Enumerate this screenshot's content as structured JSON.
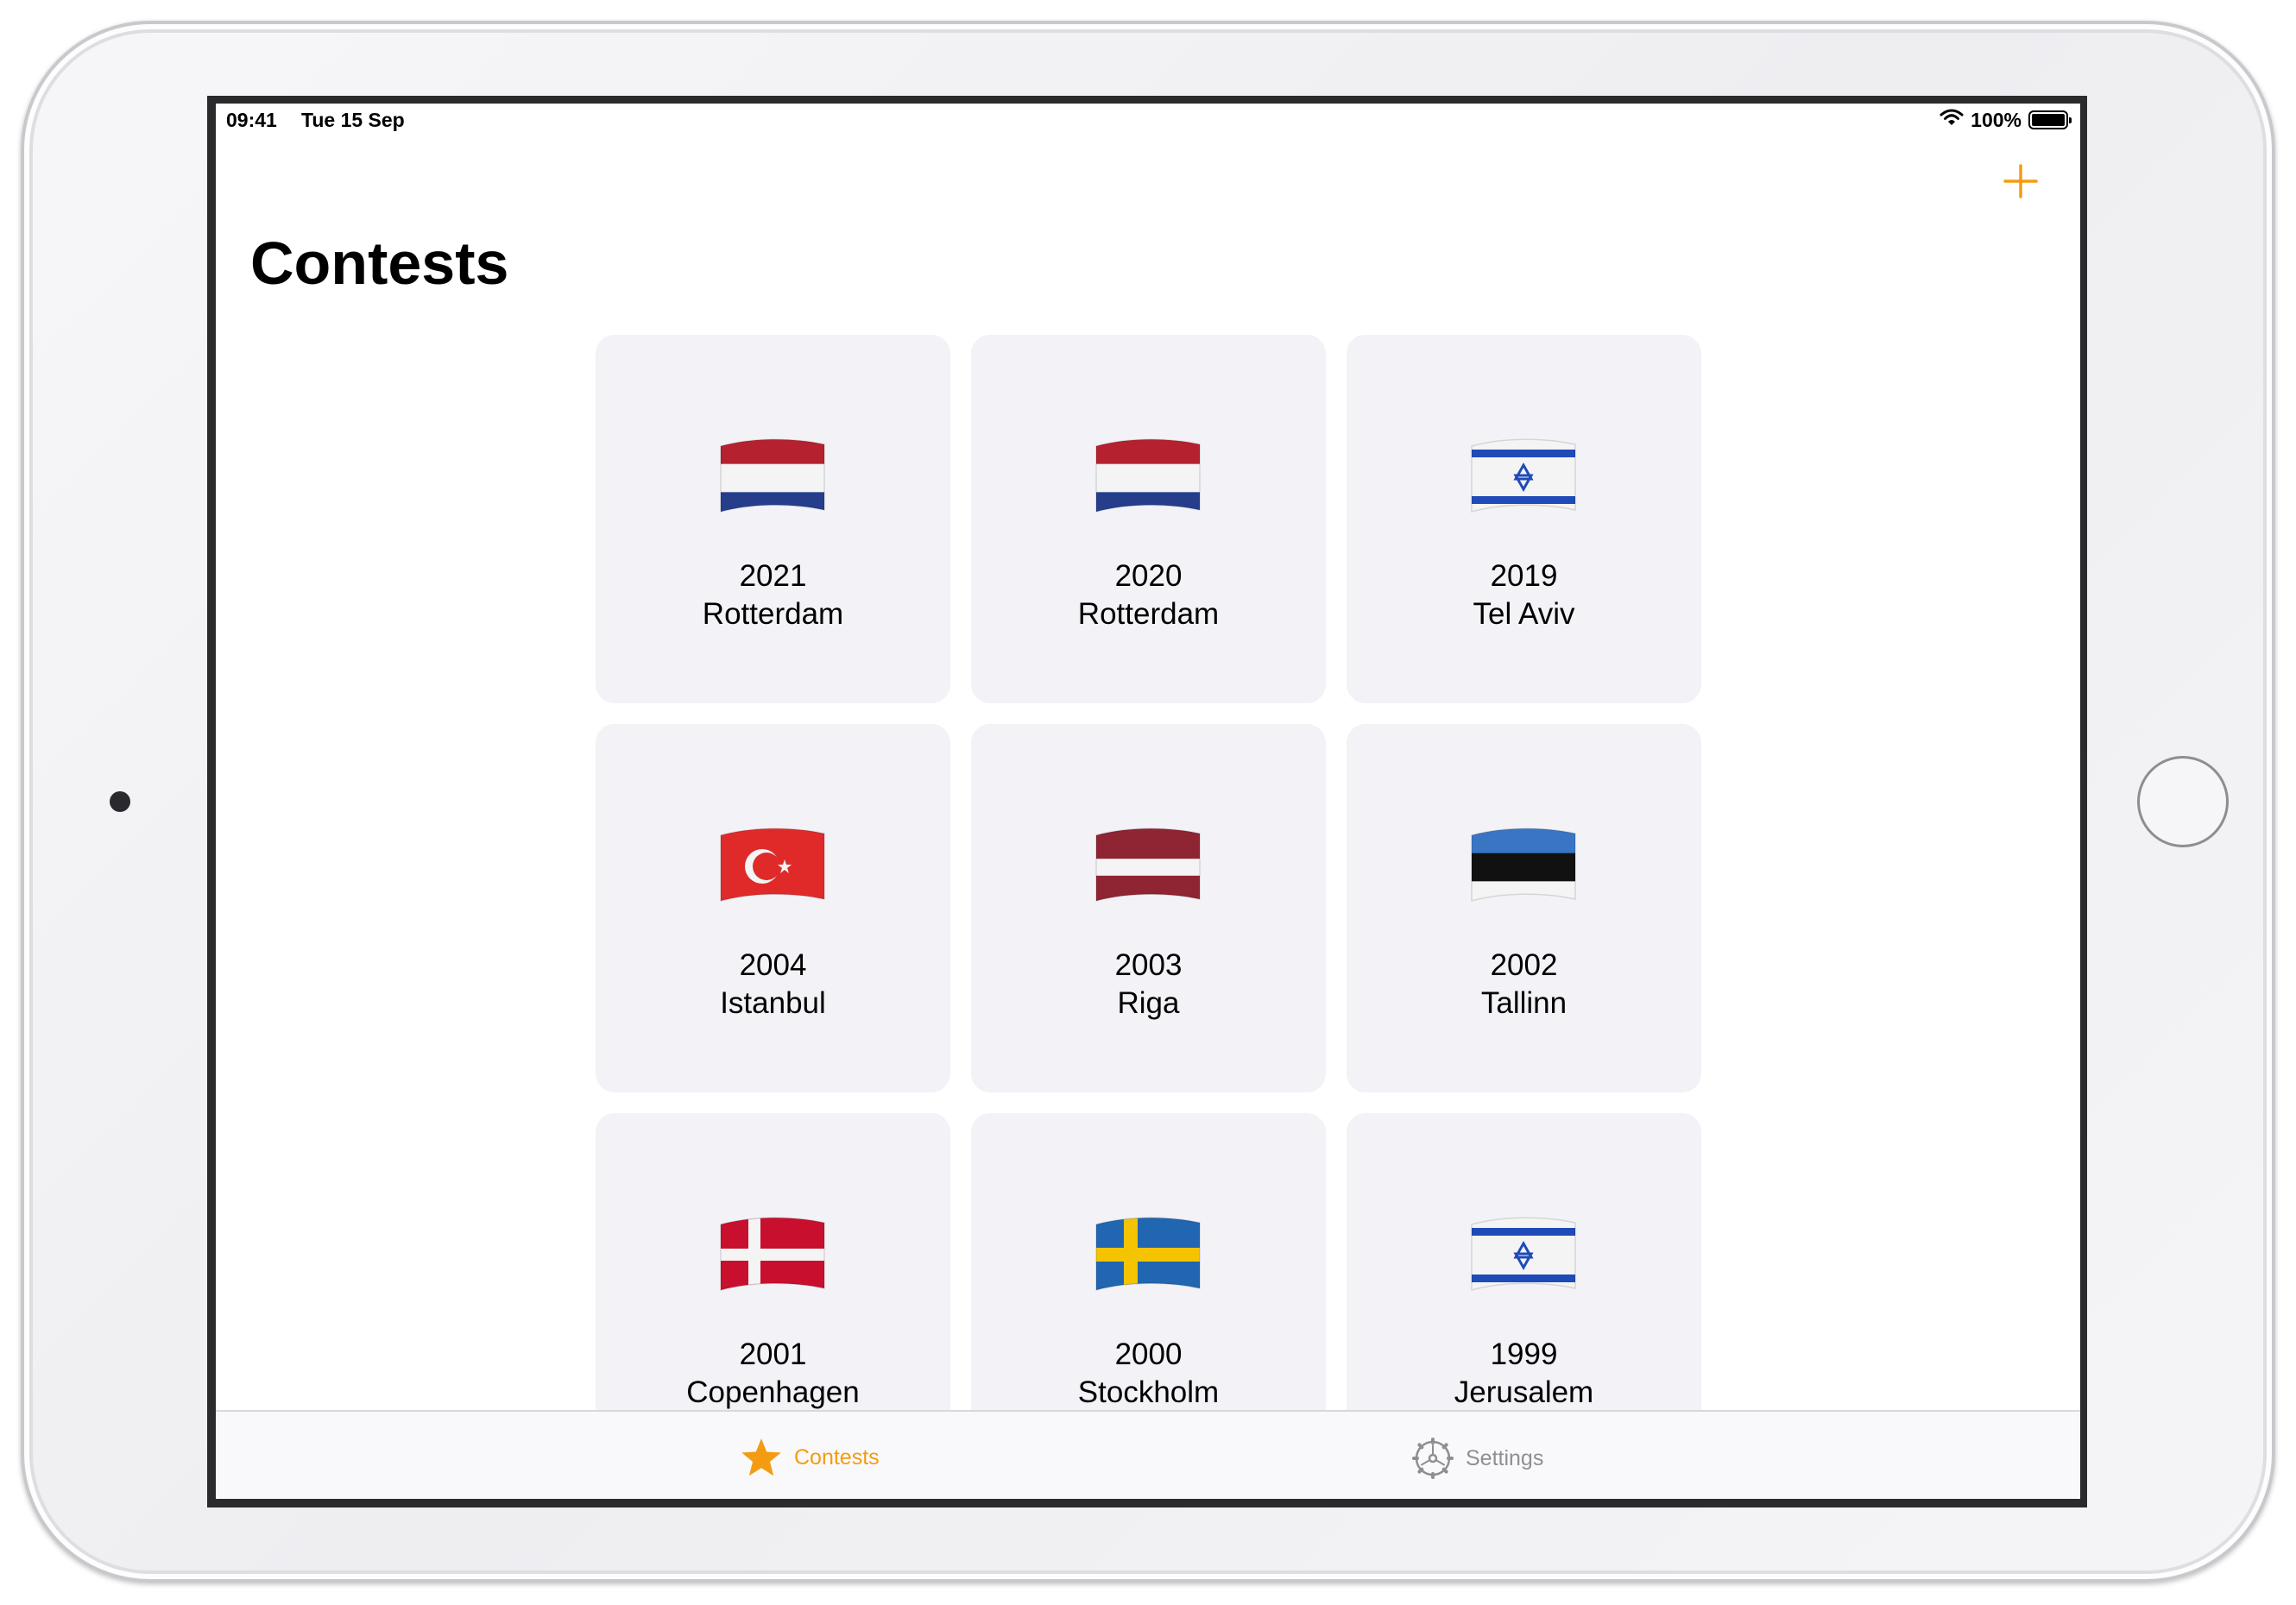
{
  "status_bar": {
    "time": "09:41",
    "date": "Tue 15 Sep",
    "battery": "100%"
  },
  "nav": {
    "title": "Contests",
    "add_icon": "plus-icon"
  },
  "contests": [
    {
      "year": "2021",
      "city": "Rotterdam",
      "flag": "netherlands"
    },
    {
      "year": "2020",
      "city": "Rotterdam",
      "flag": "netherlands"
    },
    {
      "year": "2019",
      "city": "Tel Aviv",
      "flag": "israel"
    },
    {
      "year": "2004",
      "city": "Istanbul",
      "flag": "turkey"
    },
    {
      "year": "2003",
      "city": "Riga",
      "flag": "latvia"
    },
    {
      "year": "2002",
      "city": "Tallinn",
      "flag": "estonia"
    },
    {
      "year": "2001",
      "city": "Copenhagen",
      "flag": "denmark"
    },
    {
      "year": "2000",
      "city": "Stockholm",
      "flag": "sweden"
    },
    {
      "year": "1999",
      "city": "Jerusalem",
      "flag": "israel"
    }
  ],
  "tab_bar": {
    "tabs": [
      {
        "label": "Contests",
        "icon": "star-icon",
        "selected": true
      },
      {
        "label": "Settings",
        "icon": "gear-icon",
        "selected": false
      }
    ]
  },
  "colors": {
    "accent": "#f39c12",
    "card_background": "#f2f2f7",
    "inactive_tab": "#8e8e93"
  }
}
